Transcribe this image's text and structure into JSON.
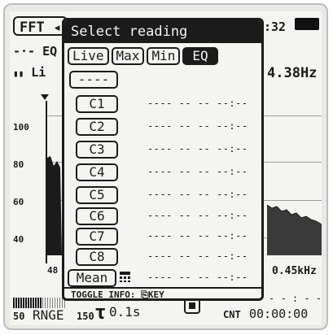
{
  "background": {
    "mode_label": "FFT",
    "mode_arrow": "◂",
    "time_fragment": ":32",
    "line1_legend": "EQ",
    "line2_legend": "Li",
    "freq_readout": "4.38Hz",
    "ticks": [
      "100",
      "80",
      "60",
      "40"
    ],
    "x_start": "48",
    "x_end": "0.45kHz",
    "range_low": "50",
    "range_label": "RNGE",
    "range_high": "150",
    "tau_symbol": "τ",
    "tau_value": "0.1s",
    "cnt_top": "- - : - -",
    "cnt_label": "CNT",
    "cnt_value": "00:00:00"
  },
  "popup": {
    "title": "Select reading",
    "tabs": [
      "Live",
      "Max",
      "Min",
      "EQ"
    ],
    "active_tab": "EQ",
    "none_button": "----",
    "channels": [
      "C1",
      "C2",
      "C3",
      "C4",
      "C5",
      "C6",
      "C7",
      "C8"
    ],
    "channel_value_placeholder": "---- -- -- --:--",
    "mean_button": "Mean",
    "mean_value_placeholder": "---- -- -- --:--",
    "calc_icon": "calculator-icon",
    "toggle_info": "TOGGLE INFO: ⎘KEY"
  },
  "colors": {
    "lcd_background": "#f4f4f1",
    "ink": "#1b1b1b",
    "frame": "#e9e9e6"
  }
}
